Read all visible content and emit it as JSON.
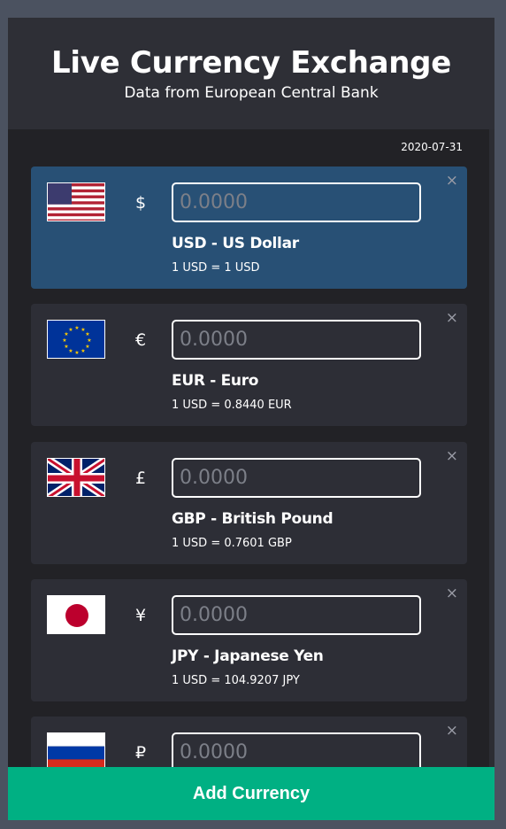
{
  "header": {
    "title": "Live Currency Exchange",
    "subtitle": "Data from European Central Bank"
  },
  "date": "2020-07-31",
  "currencies": [
    {
      "code": "USD",
      "symbol": "$",
      "name": "USD - US Dollar",
      "rate_text": "1 USD = 1 USD",
      "placeholder": "0.0000",
      "flag": "us-flag",
      "base": true
    },
    {
      "code": "EUR",
      "symbol": "€",
      "name": "EUR - Euro",
      "rate_text": "1 USD = 0.8440 EUR",
      "placeholder": "0.0000",
      "flag": "eu-flag",
      "base": false
    },
    {
      "code": "GBP",
      "symbol": "£",
      "name": "GBP - British Pound",
      "rate_text": "1 USD = 0.7601 GBP",
      "placeholder": "0.0000",
      "flag": "gb-flag",
      "base": false
    },
    {
      "code": "JPY",
      "symbol": "¥",
      "name": "JPY - Japanese Yen",
      "rate_text": "1 USD = 104.9207 JPY",
      "placeholder": "0.0000",
      "flag": "jp-flag",
      "base": false
    },
    {
      "code": "RUB",
      "symbol": "₽",
      "name": "",
      "rate_text": "",
      "placeholder": "0.0000",
      "flag": "ru-flag",
      "base": false
    }
  ],
  "close_glyph": "×",
  "add_button_label": "Add Currency",
  "colors": {
    "background": "#4b5260",
    "panel": "#222226",
    "header": "#2e2f36",
    "card": "#2d2e36",
    "base_card": "#285075",
    "accent": "#00b083"
  }
}
